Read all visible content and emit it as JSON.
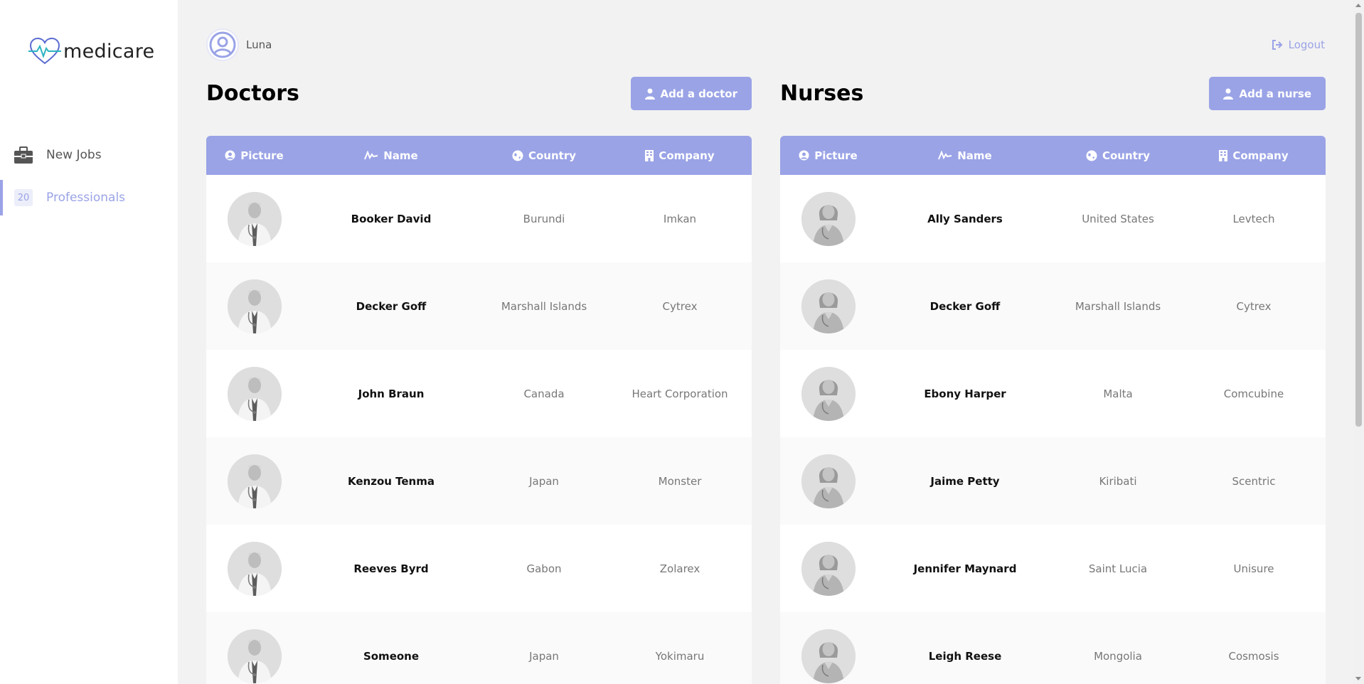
{
  "brand": {
    "name": "medicare",
    "accent": "#9aa3e6"
  },
  "sidebar": {
    "items": [
      {
        "label": "New Jobs",
        "icon": "briefcase-icon"
      },
      {
        "label": "Professionals",
        "badge": "20"
      }
    ]
  },
  "header": {
    "user_name": "Luna",
    "logout_label": "Logout"
  },
  "doctors": {
    "title": "Doctors",
    "add_label": "Add a doctor",
    "columns": [
      "Picture",
      "Name",
      "Country",
      "Company"
    ],
    "rows": [
      {
        "name": "Booker David",
        "country": "Burundi",
        "company": "Imkan"
      },
      {
        "name": "Decker Goff",
        "country": "Marshall Islands",
        "company": "Cytrex"
      },
      {
        "name": "John Braun",
        "country": "Canada",
        "company": "Heart Corporation"
      },
      {
        "name": "Kenzou Tenma",
        "country": "Japan",
        "company": "Monster"
      },
      {
        "name": "Reeves Byrd",
        "country": "Gabon",
        "company": "Zolarex"
      },
      {
        "name": "Someone",
        "country": "Japan",
        "company": "Yokimaru"
      }
    ]
  },
  "nurses": {
    "title": "Nurses",
    "add_label": "Add a nurse",
    "columns": [
      "Picture",
      "Name",
      "Country",
      "Company"
    ],
    "rows": [
      {
        "name": "Ally Sanders",
        "country": "United States",
        "company": "Levtech"
      },
      {
        "name": "Decker Goff",
        "country": "Marshall Islands",
        "company": "Cytrex"
      },
      {
        "name": "Ebony Harper",
        "country": "Malta",
        "company": "Comcubine"
      },
      {
        "name": "Jaime Petty",
        "country": "Kiribati",
        "company": "Scentric"
      },
      {
        "name": "Jennifer Maynard",
        "country": "Saint Lucia",
        "company": "Unisure"
      },
      {
        "name": "Leigh Reese",
        "country": "Mongolia",
        "company": "Cosmosis"
      }
    ]
  }
}
